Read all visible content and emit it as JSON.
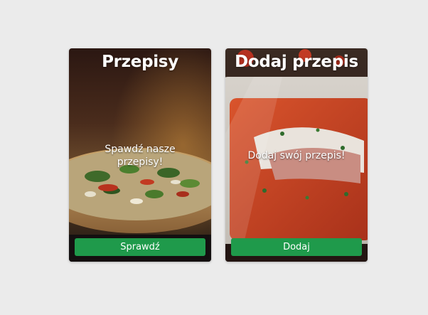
{
  "cards": [
    {
      "title": "Przepisy",
      "text": "Spawdź nasze przepisy!",
      "button_label": "Sprawdź",
      "image": "pizza-photo"
    },
    {
      "title": "Dodaj przepis",
      "text": "Dodaj swój przepis!",
      "button_label": "Dodaj",
      "image": "baked-dish-photo"
    }
  ],
  "colors": {
    "page_background": "#ebebeb",
    "button_background": "#1f9a4b",
    "text": "#ffffff"
  }
}
